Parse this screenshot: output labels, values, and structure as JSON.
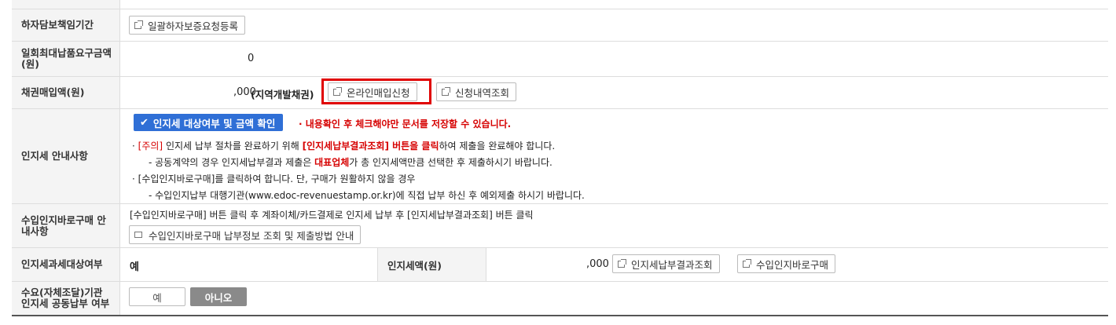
{
  "row1": {
    "label": "하자담보책임기간",
    "button": "일괄하자보증요청등록"
  },
  "row2": {
    "label": "일회최대납품요구금액(원)",
    "value": "0"
  },
  "row3": {
    "label": "채권매입액(원)",
    "value": ",000",
    "note": "(지역개발채권)",
    "btn_online": "온라인매입신청",
    "btn_history": "신청내역조회"
  },
  "row4": {
    "label": "인지세 안내사항",
    "check_button": "인지세 대상여부 및 금액 확인",
    "check_note": "· 내용확인 후 체크해야만 문서를 저장할 수 있습니다.",
    "line1_bullet": "·",
    "line1_a": "[주의]",
    "line1_b": "인지세 납부 절차를 완료하기 위해",
    "line1_c": "[인지세납부결과조회] 버튼을 클릭",
    "line1_d": "하여 제출을 완료해야 합니다.",
    "line2_a": "- 공동계약의 경우 인지세납부결과 제출은",
    "line2_b": "대표업체",
    "line2_c": "가 총 인지세액만큼 선택한 후 제출하시기 바랍니다.",
    "line3": "[수입인지바로구매]를 클릭하여 합니다. 단, 구매가 원활하지 않을 경우",
    "line4": "- 수입인지납부 대행기관(www.edoc-revenuestamp.or.kr)에 직접 납부 하신 후 예외제출 하시기 바랍니다."
  },
  "row5": {
    "label": "수입인지바로구매 안내사항",
    "text": "[수입인지바로구매] 버튼 클릭 후 계좌이체/카드결제로 인지세 납부 후 [인지세납부결과조회] 버튼 클릭",
    "button": "수입인지바로구매 납부정보 조회 및 제출방법 안내"
  },
  "row6": {
    "label": "인지세과세대상여부",
    "value": "예",
    "label2": "인지세액(원)",
    "amount": ",000",
    "btn_result": "인지세납부결과조회",
    "btn_buy": "수입인지바로구매"
  },
  "row7": {
    "label": "수요(자체조달)기관 인지세 공동납부 여부",
    "yes": "예",
    "no": "아니오"
  },
  "colors": {
    "accent": "#2f6fd6",
    "red": "#d60000",
    "highlight_border": "#e00000",
    "selected_toggle": "#8a8a8a"
  }
}
